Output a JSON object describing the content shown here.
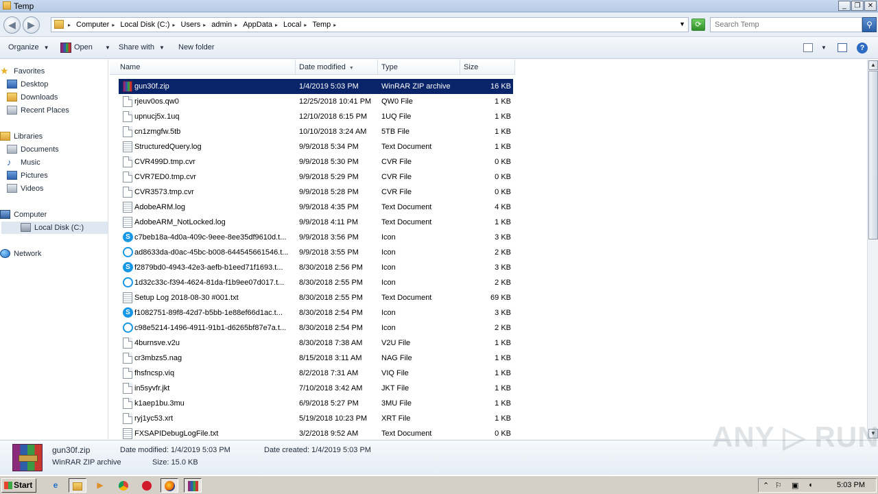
{
  "window": {
    "title": "Temp",
    "min_label": "_",
    "max_label": "❐",
    "close_label": "✕"
  },
  "address": {
    "crumbs": [
      "Computer",
      "Local Disk (C:)",
      "Users",
      "admin",
      "AppData",
      "Local",
      "Temp"
    ],
    "search_placeholder": "Search Temp"
  },
  "toolbar": {
    "organize": "Organize",
    "open": "Open",
    "share_with": "Share with",
    "new_folder": "New folder"
  },
  "nav": {
    "favorites": "Favorites",
    "desktop": "Desktop",
    "downloads": "Downloads",
    "recent_places": "Recent Places",
    "libraries": "Libraries",
    "documents": "Documents",
    "music": "Music",
    "pictures": "Pictures",
    "videos": "Videos",
    "computer": "Computer",
    "local_disk": "Local Disk (C:)",
    "network": "Network"
  },
  "columns": {
    "name": "Name",
    "date": "Date modified",
    "type": "Type",
    "size": "Size"
  },
  "files": [
    {
      "name": "gun30f.zip",
      "date": "1/4/2019 5:03 PM",
      "type": "WinRAR ZIP archive",
      "size": "16 KB",
      "icon": "winrar-icon",
      "selected": true
    },
    {
      "name": "rjeuv0os.qw0",
      "date": "12/25/2018 10:41 PM",
      "type": "QW0 File",
      "size": "1 KB",
      "icon": "file-icon"
    },
    {
      "name": "upnucj5x.1uq",
      "date": "12/10/2018 6:15 PM",
      "type": "1UQ File",
      "size": "1 KB",
      "icon": "file-icon"
    },
    {
      "name": "cn1zmgfw.5tb",
      "date": "10/10/2018 3:24 AM",
      "type": "5TB File",
      "size": "1 KB",
      "icon": "file-icon"
    },
    {
      "name": "StructuredQuery.log",
      "date": "9/9/2018 5:34 PM",
      "type": "Text Document",
      "size": "1 KB",
      "icon": "text-file-icon"
    },
    {
      "name": "CVR499D.tmp.cvr",
      "date": "9/9/2018 5:30 PM",
      "type": "CVR File",
      "size": "0 KB",
      "icon": "file-icon"
    },
    {
      "name": "CVR7ED0.tmp.cvr",
      "date": "9/9/2018 5:29 PM",
      "type": "CVR File",
      "size": "0 KB",
      "icon": "file-icon"
    },
    {
      "name": "CVR3573.tmp.cvr",
      "date": "9/9/2018 5:28 PM",
      "type": "CVR File",
      "size": "0 KB",
      "icon": "file-icon"
    },
    {
      "name": "AdobeARM.log",
      "date": "9/9/2018 4:35 PM",
      "type": "Text Document",
      "size": "4 KB",
      "icon": "text-file-icon"
    },
    {
      "name": "AdobeARM_NotLocked.log",
      "date": "9/9/2018 4:11 PM",
      "type": "Text Document",
      "size": "1 KB",
      "icon": "text-file-icon"
    },
    {
      "name": "c7beb18a-4d0a-409c-9eee-8ee35df9610d.t...",
      "date": "9/9/2018 3:56 PM",
      "type": "Icon",
      "size": "3 KB",
      "icon": "skype-icon"
    },
    {
      "name": "ad8633da-d0ac-45bc-b008-644545661546.t...",
      "date": "9/9/2018 3:55 PM",
      "type": "Icon",
      "size": "2 KB",
      "icon": "skype-outline-icon"
    },
    {
      "name": "f2879bd0-4943-42e3-aefb-b1eed71f1693.t...",
      "date": "8/30/2018 2:56 PM",
      "type": "Icon",
      "size": "3 KB",
      "icon": "skype-icon"
    },
    {
      "name": "1d32c33c-f394-4624-81da-f1b9ee07d017.t...",
      "date": "8/30/2018 2:55 PM",
      "type": "Icon",
      "size": "2 KB",
      "icon": "skype-outline-icon"
    },
    {
      "name": "Setup Log 2018-08-30 #001.txt",
      "date": "8/30/2018 2:55 PM",
      "type": "Text Document",
      "size": "69 KB",
      "icon": "text-file-icon"
    },
    {
      "name": "f1082751-89f8-42d7-b5bb-1e88ef66d1ac.t...",
      "date": "8/30/2018 2:54 PM",
      "type": "Icon",
      "size": "3 KB",
      "icon": "skype-icon"
    },
    {
      "name": "c98e5214-1496-4911-91b1-d6265bf87e7a.t...",
      "date": "8/30/2018 2:54 PM",
      "type": "Icon",
      "size": "2 KB",
      "icon": "skype-outline-icon"
    },
    {
      "name": "4burnsve.v2u",
      "date": "8/30/2018 7:38 AM",
      "type": "V2U File",
      "size": "1 KB",
      "icon": "file-icon"
    },
    {
      "name": "cr3mbzs5.nag",
      "date": "8/15/2018 3:11 AM",
      "type": "NAG File",
      "size": "1 KB",
      "icon": "file-icon"
    },
    {
      "name": "fhsfncsp.viq",
      "date": "8/2/2018 7:31 AM",
      "type": "VIQ File",
      "size": "1 KB",
      "icon": "file-icon"
    },
    {
      "name": "in5syvfr.jkt",
      "date": "7/10/2018 3:42 AM",
      "type": "JKT File",
      "size": "1 KB",
      "icon": "file-icon"
    },
    {
      "name": "k1aep1bu.3mu",
      "date": "6/9/2018 5:27 PM",
      "type": "3MU File",
      "size": "1 KB",
      "icon": "file-icon"
    },
    {
      "name": "ryj1yc53.xrt",
      "date": "5/19/2018 10:23 PM",
      "type": "XRT File",
      "size": "1 KB",
      "icon": "file-icon"
    },
    {
      "name": "FXSAPIDebugLogFile.txt",
      "date": "3/2/2018 9:52 AM",
      "type": "Text Document",
      "size": "0 KB",
      "icon": "text-file-icon"
    }
  ],
  "details": {
    "filename": "gun30f.zip",
    "filetype": "WinRAR ZIP archive",
    "date_modified_label": "Date modified:",
    "date_modified": "1/4/2019 5:03 PM",
    "date_created_label": "Date created:",
    "date_created": "1/4/2019 5:03 PM",
    "size_label": "Size:",
    "size": "15.0 KB"
  },
  "watermark": "ANY ▷ RUN",
  "taskbar": {
    "start": "Start",
    "clock": "5:03 PM"
  }
}
